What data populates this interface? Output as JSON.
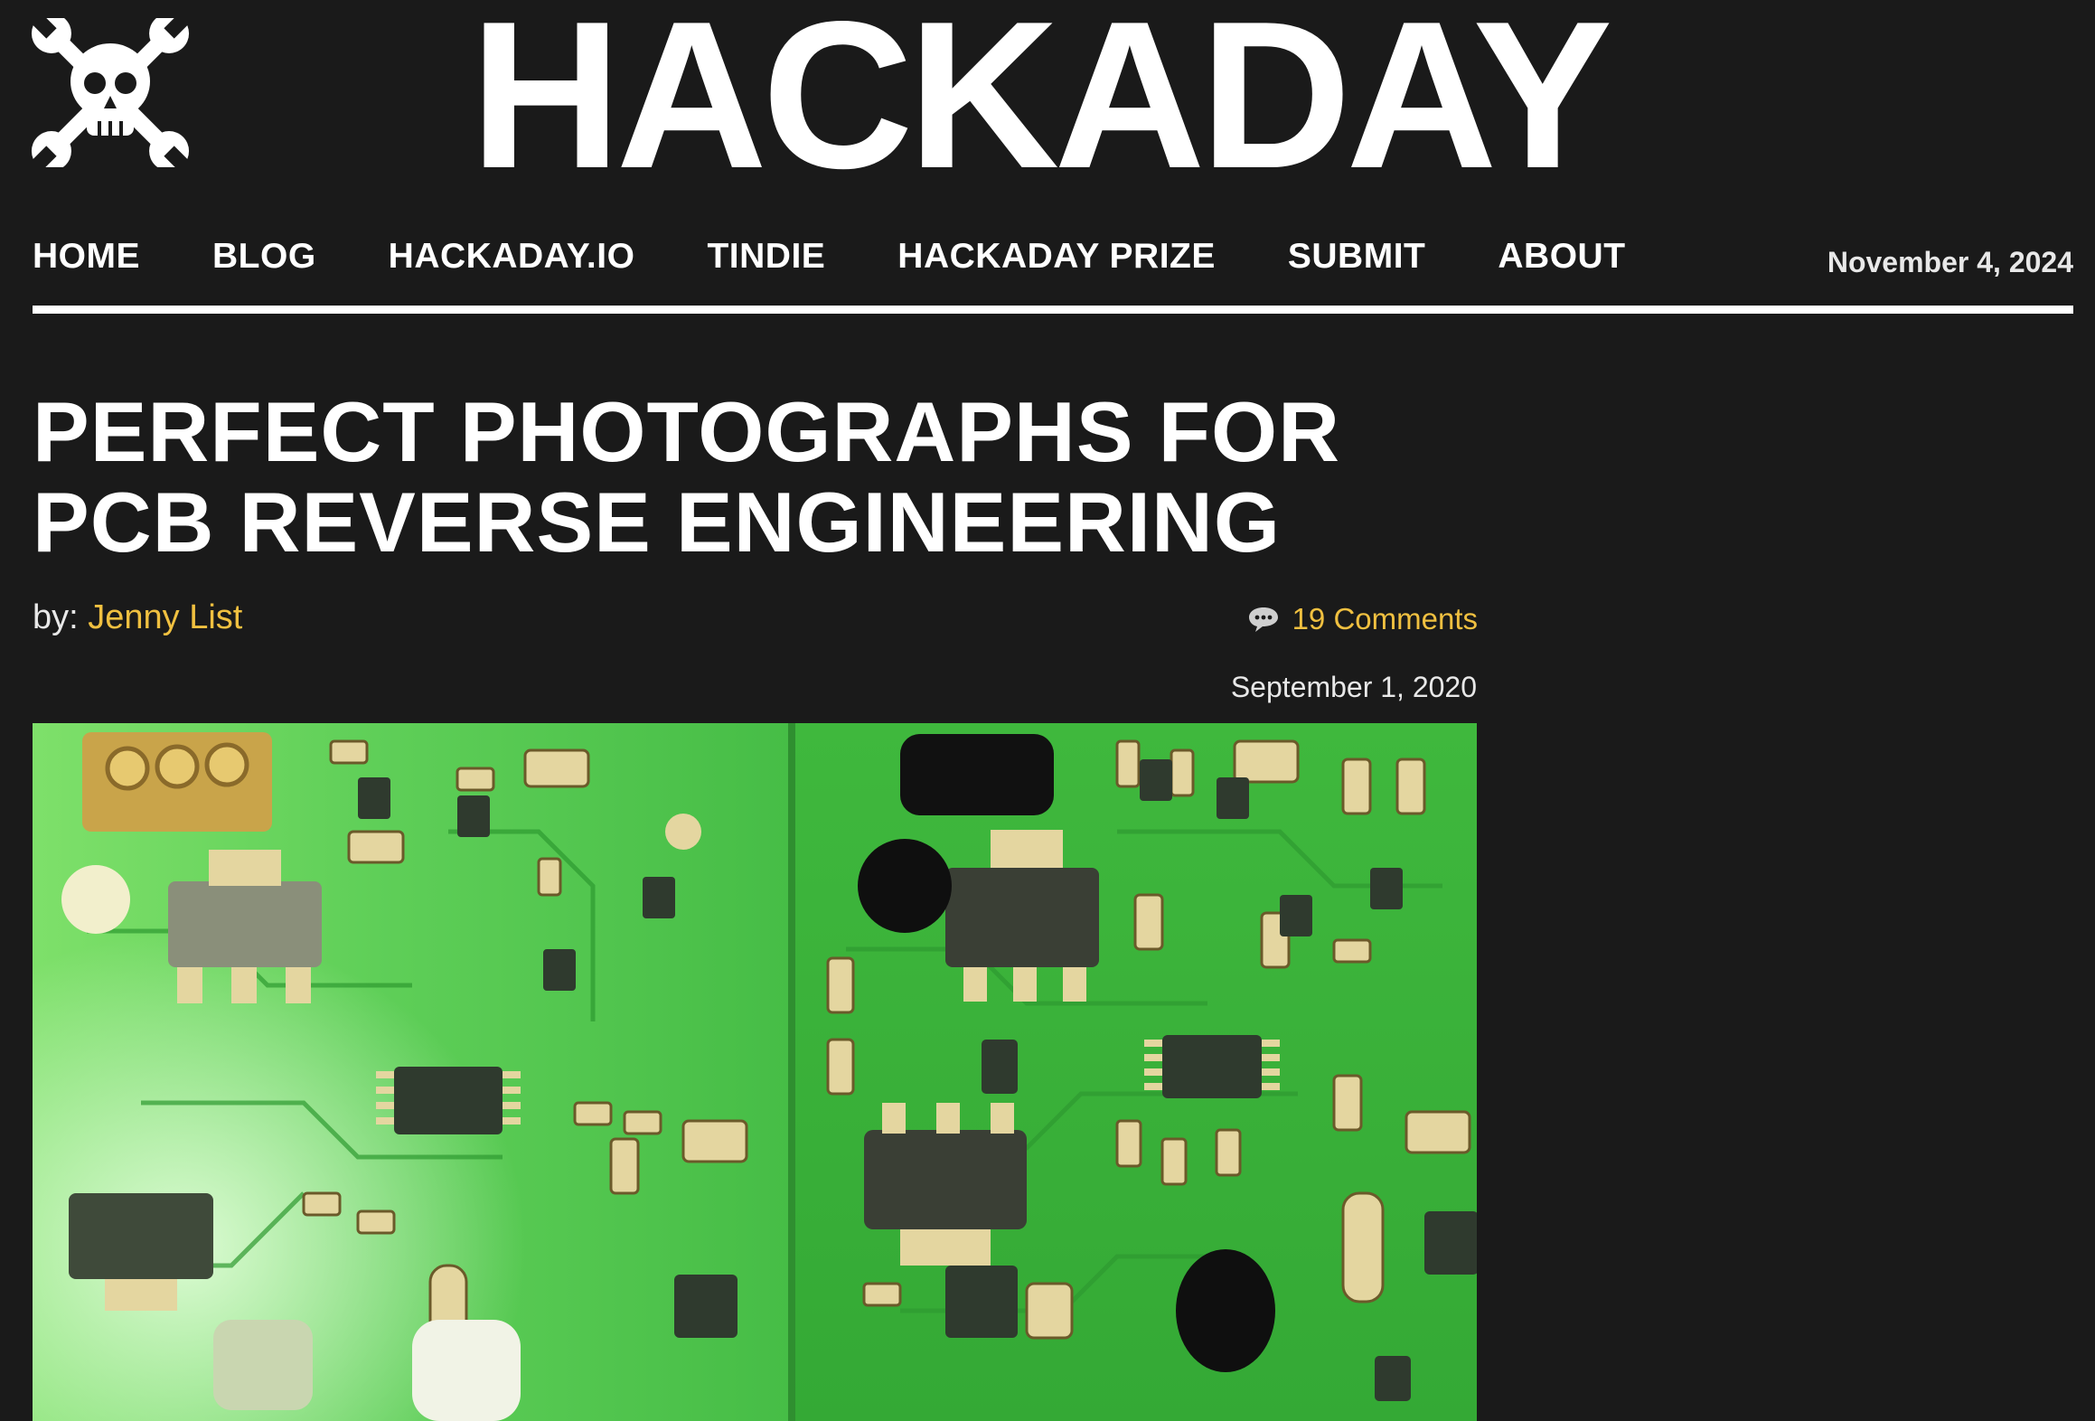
{
  "header": {
    "site_title": "HACKADAY",
    "logo_icon": "skull-and-wrenches-icon"
  },
  "nav": {
    "items": [
      "HOME",
      "BLOG",
      "HACKADAY.IO",
      "TINDIE",
      "HACKADAY PRIZE",
      "SUBMIT",
      "ABOUT"
    ],
    "date": "November 4, 2024"
  },
  "article": {
    "title_line1": "PERFECT PHOTOGRAPHS FOR",
    "title_line2": "PCB REVERSE ENGINEERING",
    "by_label": "by:",
    "author": "Jenny List",
    "comments": "19 Comments",
    "comments_icon": "speech-bubble-icon",
    "date": "September 1, 2020",
    "image": {
      "description_icon": "pcb-photo",
      "colors": {
        "board": "#3cb53c",
        "board_light": "#8ee07a",
        "pad": "#d9c27a"
      }
    }
  },
  "colors": {
    "background": "#1a1a1a",
    "accent": "#f0c040",
    "text": "#ffffff"
  }
}
